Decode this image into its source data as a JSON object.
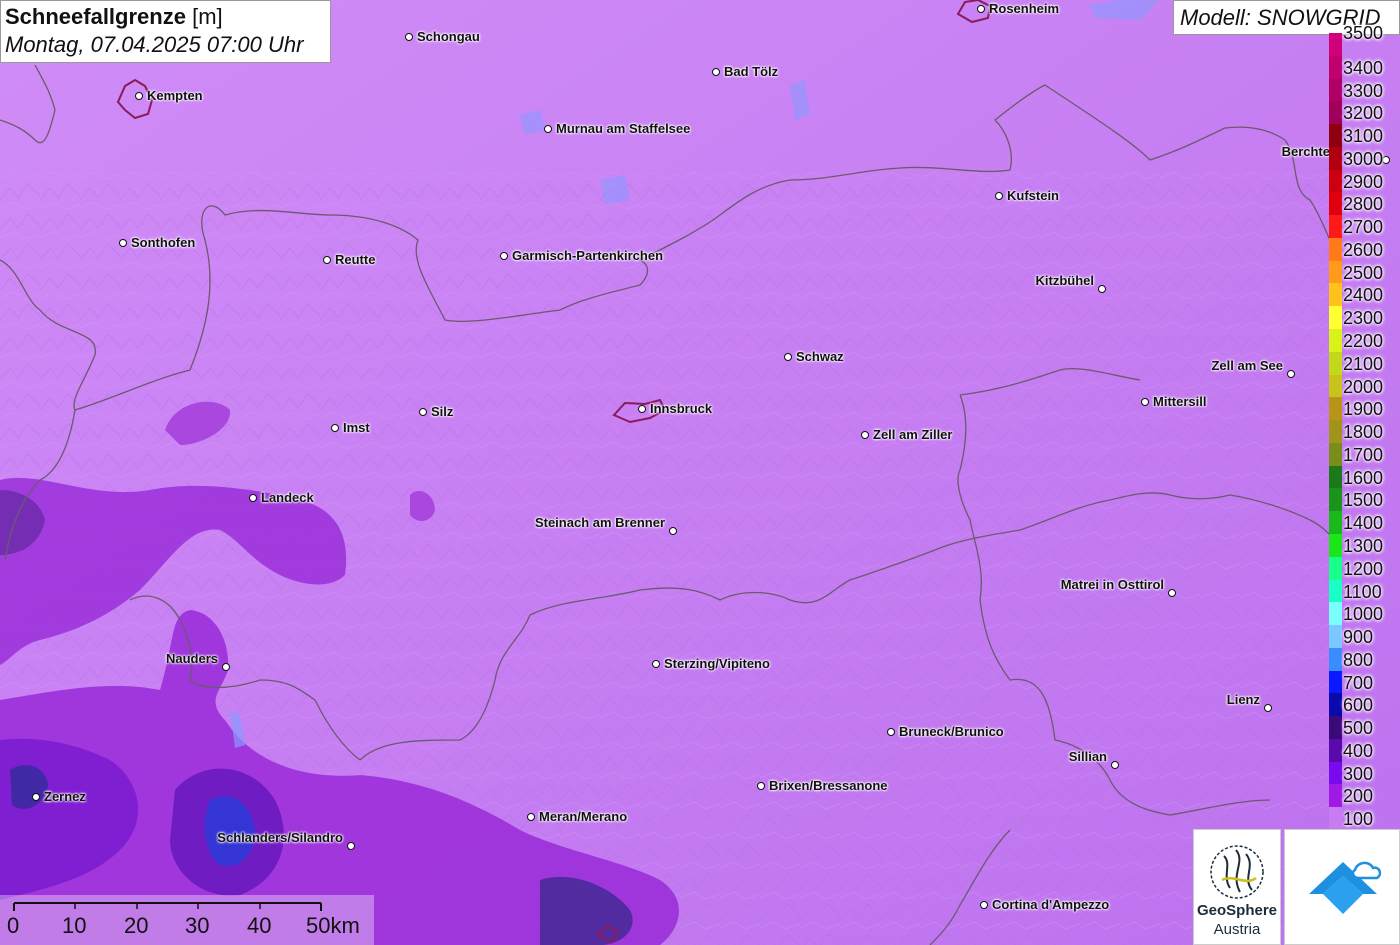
{
  "title": {
    "parameter": "Schneefallgrenze",
    "unit": "[m]",
    "datetime": "Montag, 07.04.2025 07:00 Uhr"
  },
  "model": "Modell: SNOWGRID",
  "cities": [
    {
      "name": "Rosenheim",
      "side": "right"
    },
    {
      "name": "Schongau",
      "side": "right"
    },
    {
      "name": "Kempten",
      "side": "right"
    },
    {
      "name": "Bad Tölz",
      "side": "right"
    },
    {
      "name": "Murnau am Staffelsee",
      "side": "right"
    },
    {
      "name": "Berchte",
      "side": "left"
    },
    {
      "name": "Kufstein",
      "side": "right"
    },
    {
      "name": "Sonthofen",
      "side": "right"
    },
    {
      "name": "Reutte",
      "side": "right"
    },
    {
      "name": "Garmisch-Partenkirchen",
      "side": "right"
    },
    {
      "name": "Kitzbühel",
      "side": "left"
    },
    {
      "name": "Schwaz",
      "side": "right"
    },
    {
      "name": "Zell am See",
      "side": "left"
    },
    {
      "name": "Mittersill",
      "side": "right"
    },
    {
      "name": "Innsbruck",
      "side": "right"
    },
    {
      "name": "Silz",
      "side": "right"
    },
    {
      "name": "Imst",
      "side": "right"
    },
    {
      "name": "Zell am Ziller",
      "side": "right"
    },
    {
      "name": "Landeck",
      "side": "right"
    },
    {
      "name": "Steinach am Brenner",
      "side": "left"
    },
    {
      "name": "Matrei in Osttirol",
      "side": "left"
    },
    {
      "name": "Nauders",
      "side": "left"
    },
    {
      "name": "Sterzing/Vipiteno",
      "side": "right"
    },
    {
      "name": "Lienz",
      "side": "left"
    },
    {
      "name": "Bruneck/Brunico",
      "side": "right"
    },
    {
      "name": "Sillian",
      "side": "left"
    },
    {
      "name": "Zernez",
      "side": "right"
    },
    {
      "name": "Brixen/Bressanone",
      "side": "right"
    },
    {
      "name": "Meran/Merano",
      "side": "right"
    },
    {
      "name": "Schlanders/Silandro",
      "side": "left"
    },
    {
      "name": "Cortina d'Ampezzo",
      "side": "right"
    }
  ],
  "legend": {
    "levels": [
      {
        "label": "3500",
        "color": "#d0007a"
      },
      {
        "label": "3400",
        "color": "#c0006f"
      },
      {
        "label": "3300",
        "color": "#b00066"
      },
      {
        "label": "3200",
        "color": "#a0005c"
      },
      {
        "label": "3100",
        "color": "#8c0010"
      },
      {
        "label": "3000",
        "color": "#b00010"
      },
      {
        "label": "2900",
        "color": "#cc0010"
      },
      {
        "label": "2800",
        "color": "#e00010"
      },
      {
        "label": "2700",
        "color": "#ff1a1a"
      },
      {
        "label": "2600",
        "color": "#ff7a1a"
      },
      {
        "label": "2500",
        "color": "#ff9a1a"
      },
      {
        "label": "2400",
        "color": "#ffc21a"
      },
      {
        "label": "2300",
        "color": "#ffff33"
      },
      {
        "label": "2200",
        "color": "#d8f21a"
      },
      {
        "label": "2100",
        "color": "#c2d91a"
      },
      {
        "label": "2000",
        "color": "#c8c21a"
      },
      {
        "label": "1900",
        "color": "#b8941a"
      },
      {
        "label": "1800",
        "color": "#a0941a"
      },
      {
        "label": "1700",
        "color": "#7a8c1a"
      },
      {
        "label": "1600",
        "color": "#1a7a1a"
      },
      {
        "label": "1500",
        "color": "#1a941a"
      },
      {
        "label": "1400",
        "color": "#1ab81a"
      },
      {
        "label": "1300",
        "color": "#1ae61a"
      },
      {
        "label": "1200",
        "color": "#1aff8c"
      },
      {
        "label": "1100",
        "color": "#1affc8"
      },
      {
        "label": "1000",
        "color": "#7affff"
      },
      {
        "label": "900",
        "color": "#7ac8ff"
      },
      {
        "label": "800",
        "color": "#3a8cff"
      },
      {
        "label": "700",
        "color": "#0a1aff"
      },
      {
        "label": "600",
        "color": "#0a0aaa"
      },
      {
        "label": "500",
        "color": "#3a0a7a"
      },
      {
        "label": "400",
        "color": "#5a0aaa"
      },
      {
        "label": "300",
        "color": "#7a0aee"
      },
      {
        "label": "200",
        "color": "#a01ae6"
      },
      {
        "label": "100",
        "color": "#c77cf2"
      }
    ]
  },
  "scale": {
    "labels": [
      "0",
      "10",
      "20",
      "30",
      "40",
      "50km"
    ]
  },
  "logos": {
    "geosphere_line1": "GeoSphere",
    "geosphere_line2": "Austria"
  },
  "colors": {
    "base_fill": "#c77cf2",
    "low_fill": "#9b2fd9",
    "lower_fill": "#7a1ad0",
    "lowest_fill": "#2a3ad8",
    "border_line": "#6a5a6e",
    "city_outline": "#8a1a5a"
  }
}
